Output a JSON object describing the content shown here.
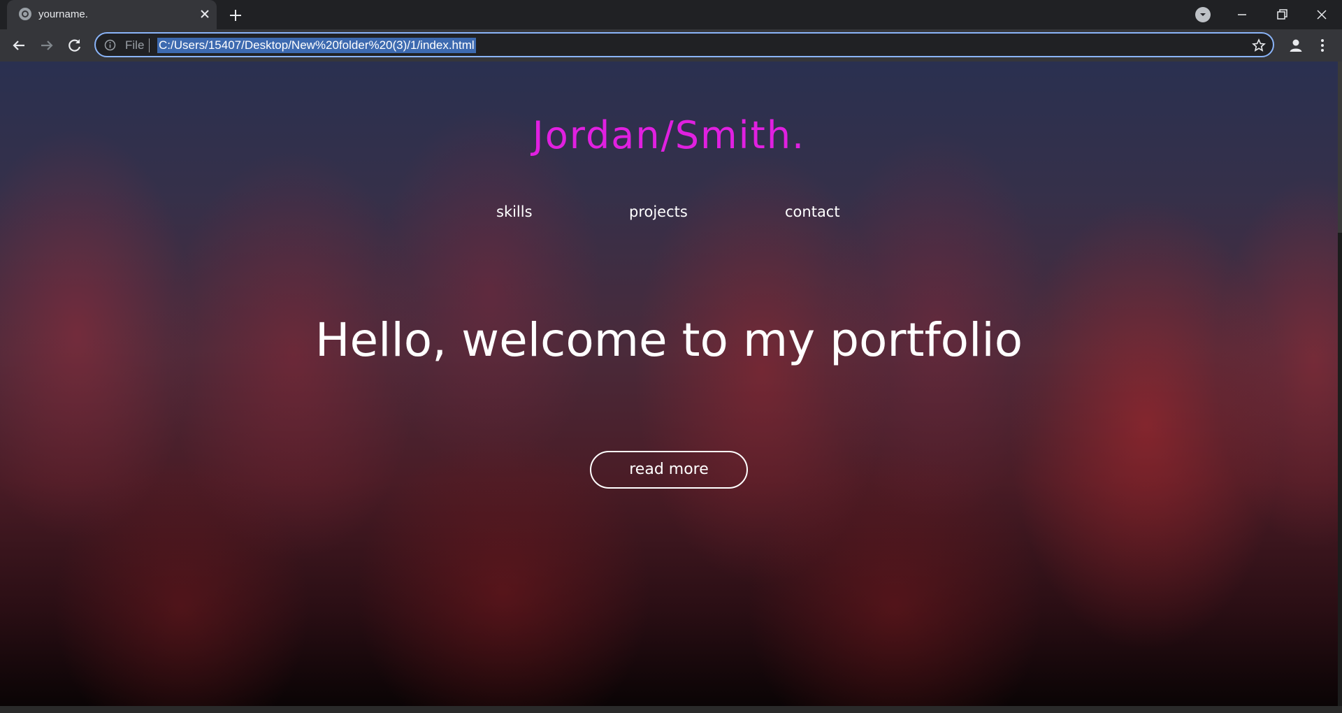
{
  "browser": {
    "tab_title": "yourname.",
    "address_prefix": "File",
    "url": "C:/Users/15407/Desktop/New%20folder%20(3)/1/index.html"
  },
  "page": {
    "logo": "Jordan/Smith.",
    "nav": [
      {
        "label": "skills"
      },
      {
        "label": "projects"
      },
      {
        "label": "contact"
      }
    ],
    "hero_title": "Hello, welcome to my portfolio",
    "cta_label": "read more"
  },
  "colors": {
    "logo": "#e020e0",
    "omnibox_focus": "#8ab4f8",
    "browser_chrome": "#202124"
  }
}
